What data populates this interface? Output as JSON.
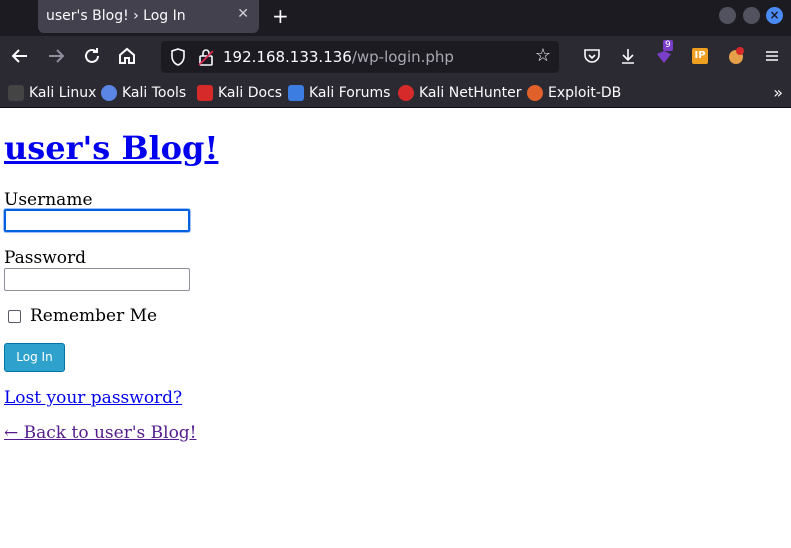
{
  "browser": {
    "tab_title": "user's Blog! › Log In",
    "tab_close": "✕",
    "new_tab": "+",
    "url_host": "192.168.133.136",
    "url_path": "/wp-login.php",
    "ext1_badge": "9",
    "icons": {
      "back": "arrow-left-icon",
      "forward": "arrow-right-icon",
      "reload": "reload-icon",
      "home": "home-icon",
      "shield": "shield-icon",
      "lock": "lock-icon",
      "star": "star-icon",
      "pocket": "pocket-icon",
      "download": "download-icon",
      "menu": "hamburger-menu-icon"
    },
    "accent": "#4b8bf5"
  },
  "bookmarks": [
    {
      "label": "Kali Linux",
      "color": "#d9d9d9"
    },
    {
      "label": "Kali Tools",
      "color": "#5b86e5"
    },
    {
      "label": "Kali Docs",
      "color": "#d62a2a"
    },
    {
      "label": "Kali Forums",
      "color": "#3b7de0"
    },
    {
      "label": "Kali NetHunter",
      "color": "#d62a2a"
    },
    {
      "label": "Exploit-DB",
      "color": "#e0622a"
    }
  ],
  "page": {
    "site_title": "user's Blog!",
    "username_label": "Username",
    "username_value": "",
    "password_label": "Password",
    "password_value": "",
    "remember_label": "Remember Me",
    "login_button": "Log In",
    "lost_password": "Lost your password?",
    "back_link": "← Back to user's Blog!",
    "link_color": "#0000ee",
    "visited_color": "#551a8b",
    "button_color": "#2ea2cc"
  }
}
